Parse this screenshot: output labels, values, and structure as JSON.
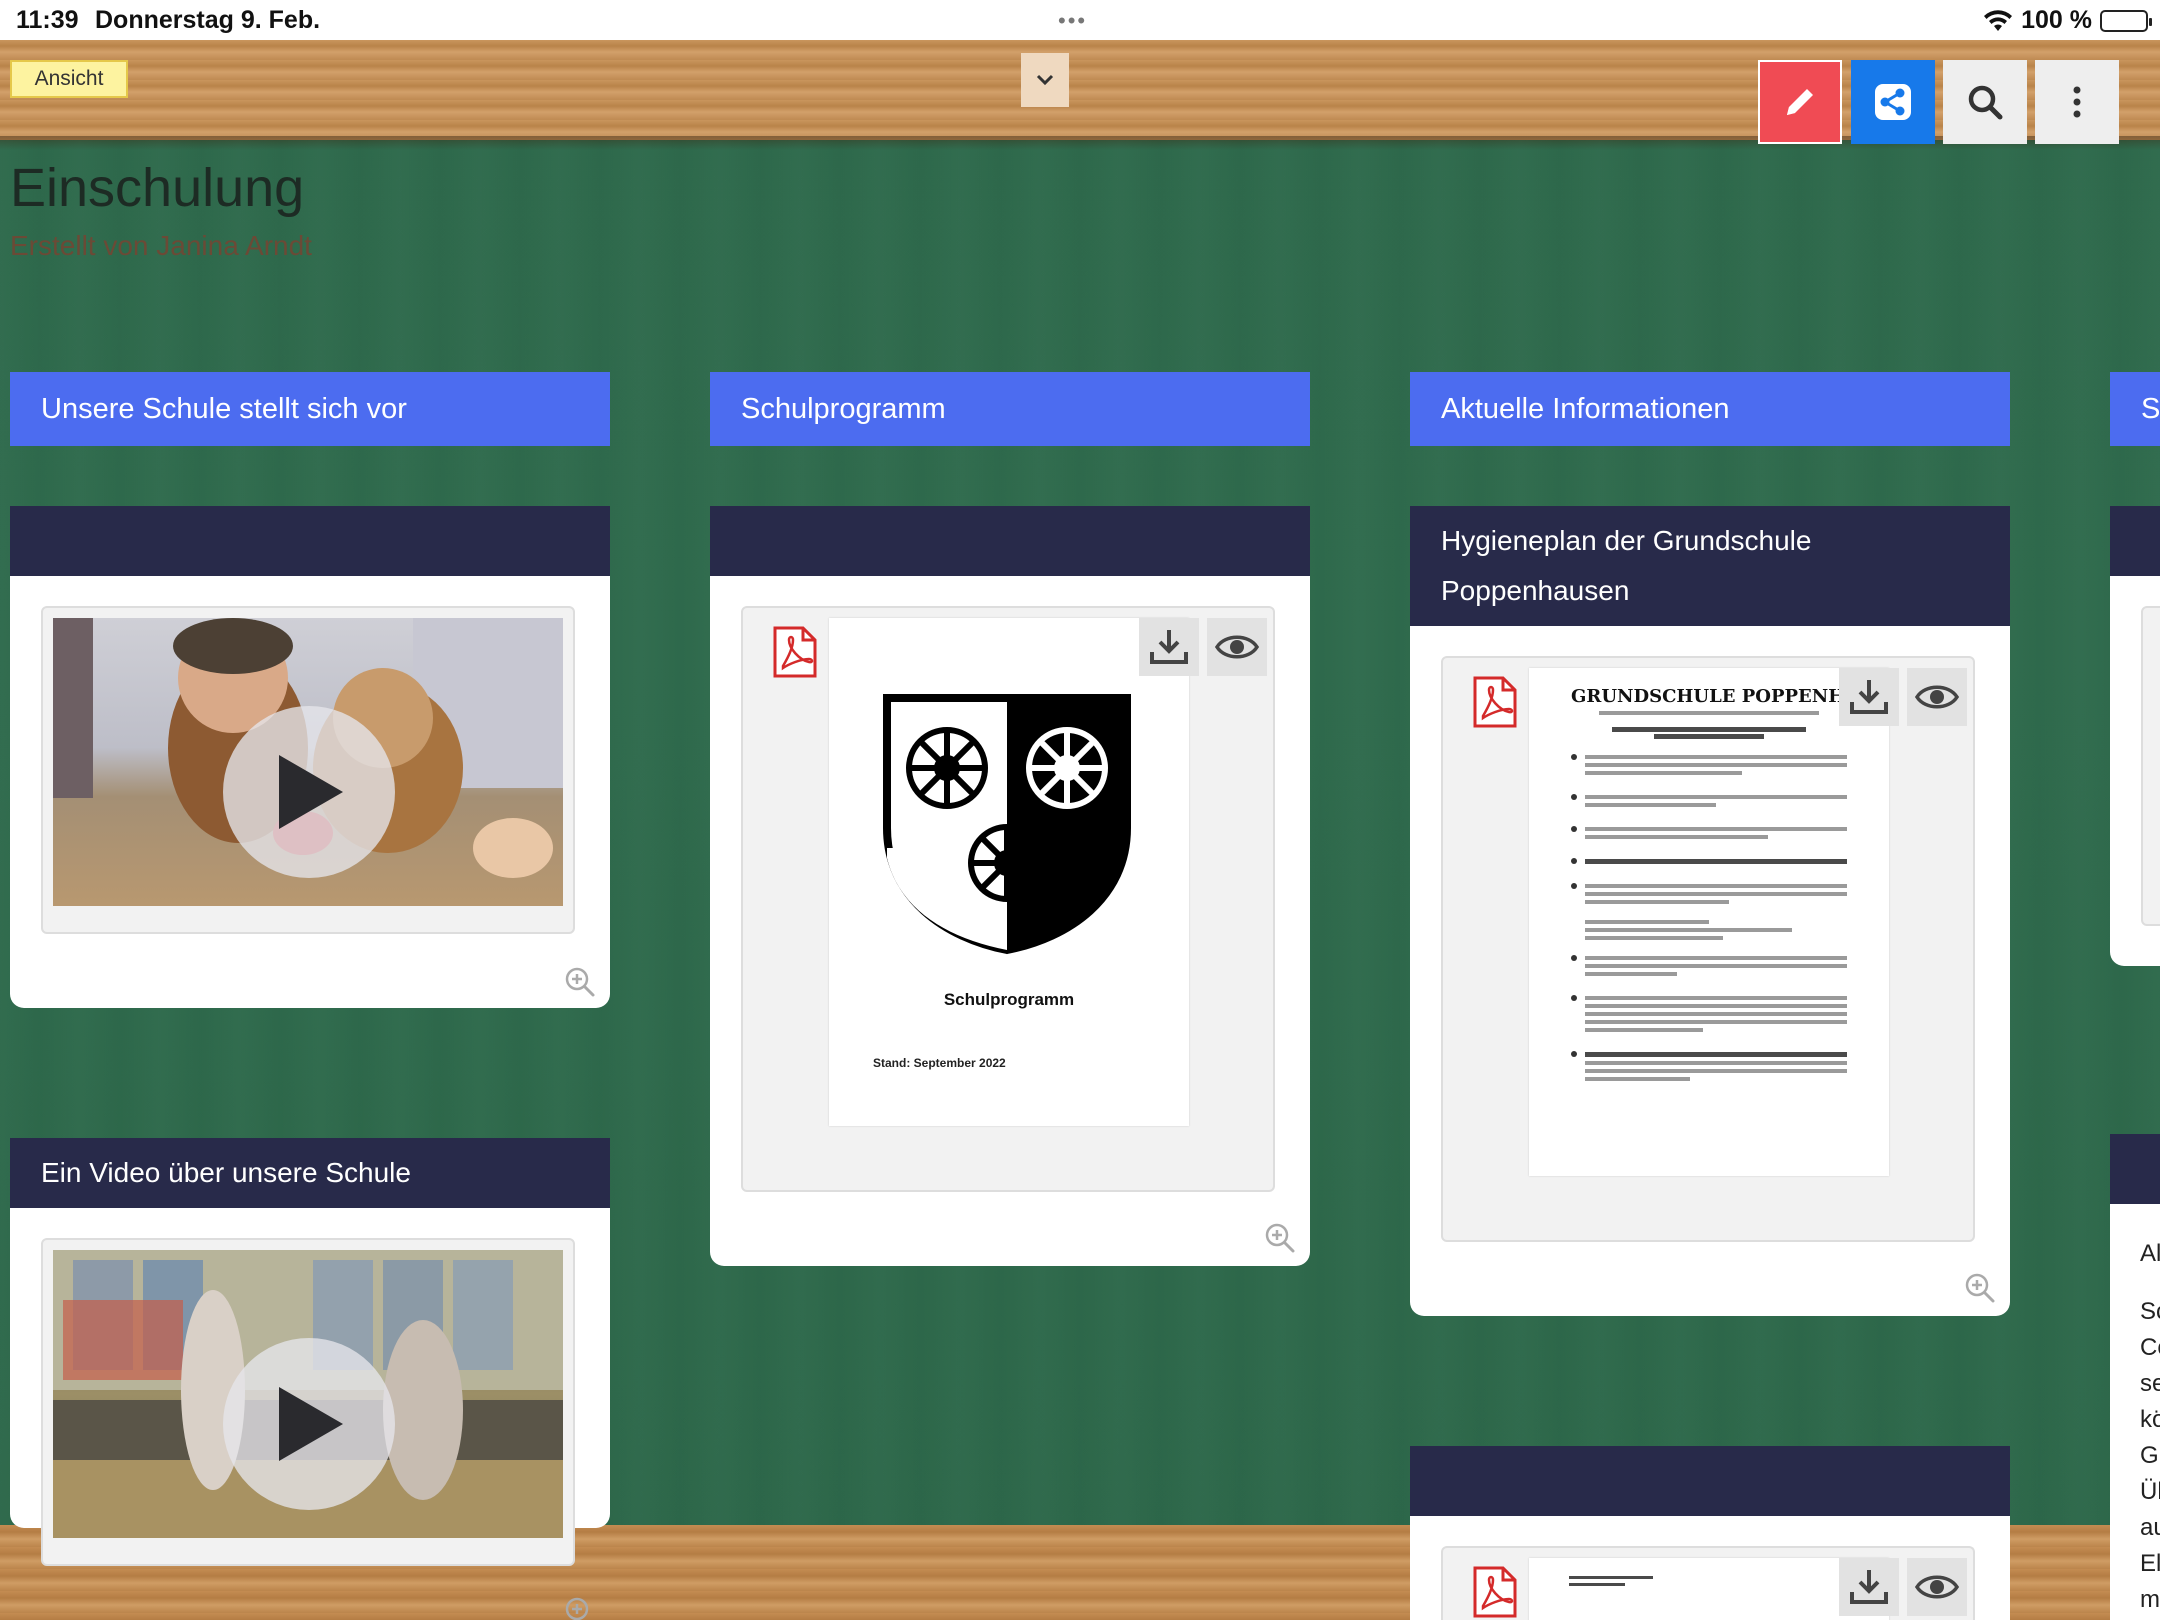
{
  "statusbar": {
    "time": "11:39",
    "date": "Donnerstag 9. Feb.",
    "dots": "•••",
    "battery": "100 %"
  },
  "toolbar": {
    "view_label": "Ansicht",
    "icons": {
      "dropdown": "chevron-down-icon",
      "edit": "pencil-icon",
      "share": "share-icon",
      "search": "search-icon",
      "more": "more-vertical-icon"
    }
  },
  "board": {
    "title": "Einschulung",
    "author": "Erstellt von Janina Arndt"
  },
  "columns": [
    {
      "title": "Unsere Schule stellt sich vor",
      "cards": [
        {
          "title": "",
          "type": "video"
        },
        {
          "title": "Ein Video über unsere Schule",
          "type": "video"
        }
      ]
    },
    {
      "title": "Schulprogramm",
      "cards": [
        {
          "title": "",
          "type": "pdf",
          "doc_title": "Schulprogramm",
          "doc_date": "Stand: September 2022"
        }
      ]
    },
    {
      "title": "Aktuelle Informationen",
      "cards": [
        {
          "title": "Hygieneplan der Grundschule Poppenhausen",
          "title_line1": "Hygieneplan der Grundschule",
          "title_line2": "Poppenhausen",
          "type": "pdf",
          "doc_heading": "GRUNDSCHULE POPPENHAUSEN"
        },
        {
          "title": "",
          "type": "pdf"
        }
      ]
    },
    {
      "title": "S",
      "partial_lines": [
        "Al",
        "Sc",
        "Co",
        "se",
        "kö",
        "G",
        "Ül",
        "au",
        "El",
        "m"
      ]
    }
  ],
  "colors": {
    "column_header": "#4c6cf0",
    "card_header": "#282a4a",
    "edit_button": "#f04b54",
    "share_button": "#1779ea",
    "pdf_icon": "#d42a2a"
  }
}
